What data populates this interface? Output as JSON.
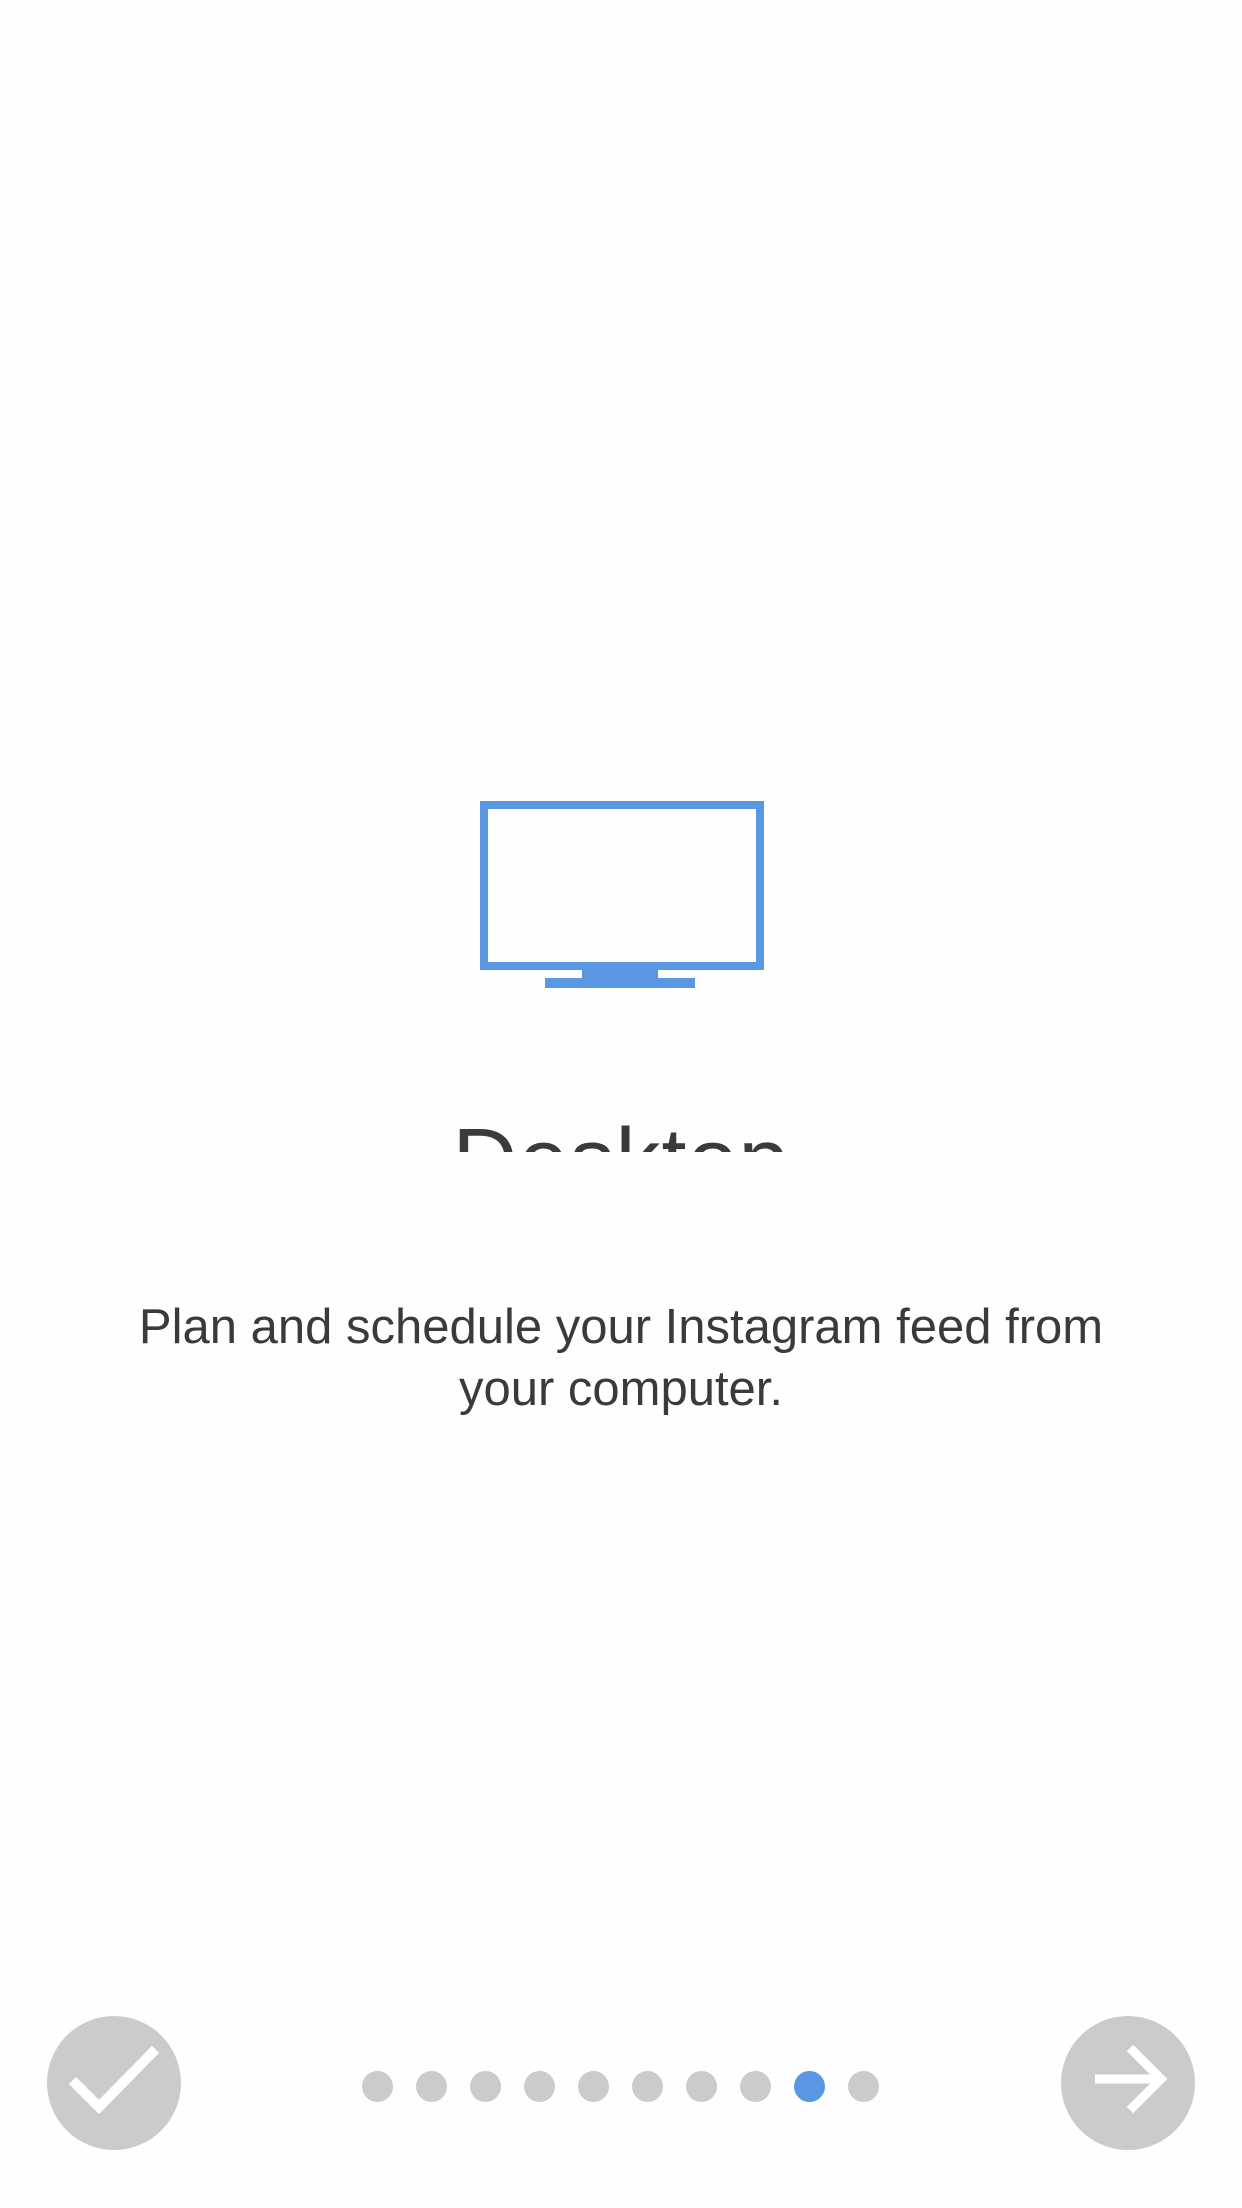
{
  "slide": {
    "icon": "desktop-monitor-icon",
    "title": "Desktop",
    "description": "Plan and schedule your Instagram feed from your computer."
  },
  "pager": {
    "total_pages": 10,
    "current_page": 9
  },
  "buttons": {
    "done_icon": "checkmark-icon",
    "next_icon": "arrow-right-icon"
  },
  "colors": {
    "accent": "#5a97e2",
    "inactive": "#cbcbcb",
    "text": "#3a3a3c",
    "background": "#fefefe"
  }
}
